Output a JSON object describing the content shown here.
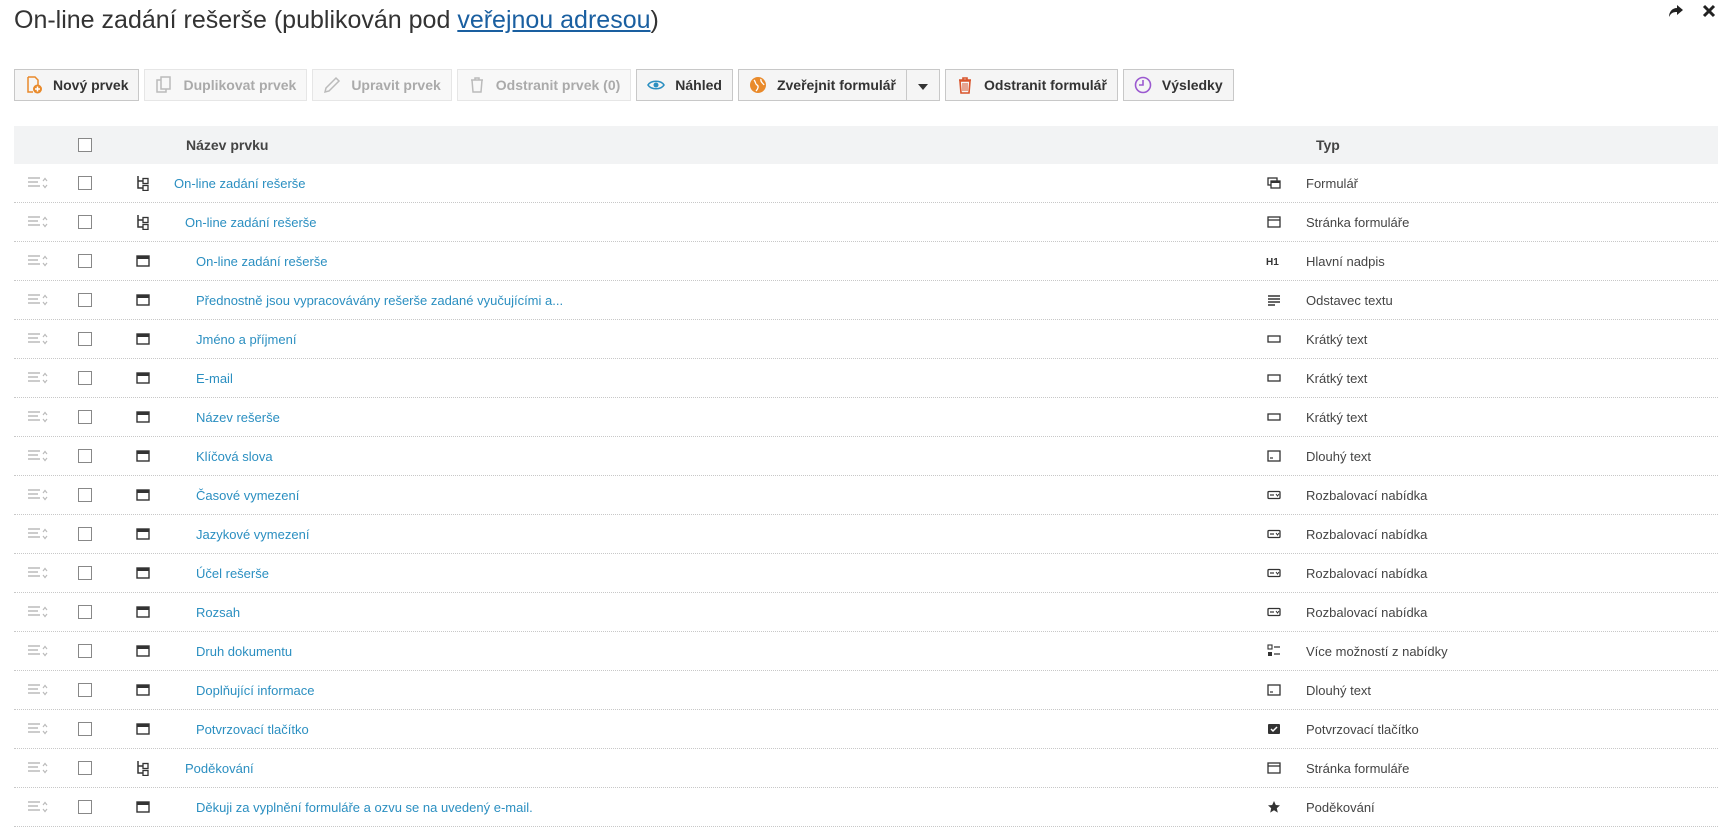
{
  "header": {
    "title_before": "On-line zadání rešerše (publikován pod ",
    "title_link": "veřejnou adresou",
    "title_after": ")",
    "share_icon": "share-arrow-icon",
    "close_icon": "close-icon"
  },
  "toolbar": {
    "new": "Nový prvek",
    "duplicate": "Duplikovat prvek",
    "edit": "Upravit prvek",
    "remove": "Odstranit prvek (0)",
    "preview": "Náhled",
    "publish": "Zveřejnit formulář",
    "delete_form": "Odstranit formulář",
    "results": "Výsledky"
  },
  "colors": {
    "link": "#2b8fc1",
    "orange": "#e98a2b",
    "red": "#d9542b",
    "preview": "#2b8fc1",
    "results": "#9b59d0"
  },
  "table": {
    "col_name": "Název prvku",
    "col_type": "Typ",
    "rows": [
      {
        "name": "On-line zadání rešerše",
        "type": "Formulář",
        "level": 0,
        "node": "tree",
        "type_icon": "form-icon"
      },
      {
        "name": "On-line zadání rešerše",
        "type": "Stránka formuláře",
        "level": 1,
        "node": "tree",
        "type_icon": "page-icon"
      },
      {
        "name": "On-line zadání rešerše",
        "type": "Hlavní nadpis",
        "level": 2,
        "node": "item",
        "type_icon": "h1-icon"
      },
      {
        "name": "Přednostně jsou vypracovávány rešerše zadané vyučujícími a...",
        "type": "Odstavec textu",
        "level": 2,
        "node": "item",
        "type_icon": "paragraph-icon"
      },
      {
        "name": "Jméno a příjmení",
        "type": "Krátký text",
        "level": 2,
        "node": "item",
        "type_icon": "short-text-icon"
      },
      {
        "name": "E-mail",
        "type": "Krátký text",
        "level": 2,
        "node": "item",
        "type_icon": "short-text-icon"
      },
      {
        "name": "Název rešerše",
        "type": "Krátký text",
        "level": 2,
        "node": "item",
        "type_icon": "short-text-icon"
      },
      {
        "name": "Klíčová slova",
        "type": "Dlouhý text",
        "level": 2,
        "node": "item",
        "type_icon": "long-text-icon"
      },
      {
        "name": "Časové vymezení",
        "type": "Rozbalovací nabídka",
        "level": 2,
        "node": "item",
        "type_icon": "dropdown-icon"
      },
      {
        "name": "Jazykové vymezení",
        "type": "Rozbalovací nabídka",
        "level": 2,
        "node": "item",
        "type_icon": "dropdown-icon"
      },
      {
        "name": "Účel rešerše",
        "type": "Rozbalovací nabídka",
        "level": 2,
        "node": "item",
        "type_icon": "dropdown-icon"
      },
      {
        "name": "Rozsah",
        "type": "Rozbalovací nabídka",
        "level": 2,
        "node": "item",
        "type_icon": "dropdown-icon"
      },
      {
        "name": "Druh dokumentu",
        "type": "Více možností z nabídky",
        "level": 2,
        "node": "item",
        "type_icon": "multi-choice-icon"
      },
      {
        "name": "Doplňující informace",
        "type": "Dlouhý text",
        "level": 2,
        "node": "item",
        "type_icon": "long-text-icon"
      },
      {
        "name": "Potvrzovací tlačítko",
        "type": "Potvrzovací tlačítko",
        "level": 2,
        "node": "item",
        "type_icon": "submit-icon"
      },
      {
        "name": "Poděkování",
        "type": "Stránka formuláře",
        "level": 1,
        "node": "tree",
        "type_icon": "page-icon"
      },
      {
        "name": "Děkuji za vyplnění formuláře a ozvu se na uvedený e-mail.",
        "type": "Poděkování",
        "level": 2,
        "node": "item",
        "type_icon": "star-icon"
      }
    ]
  }
}
